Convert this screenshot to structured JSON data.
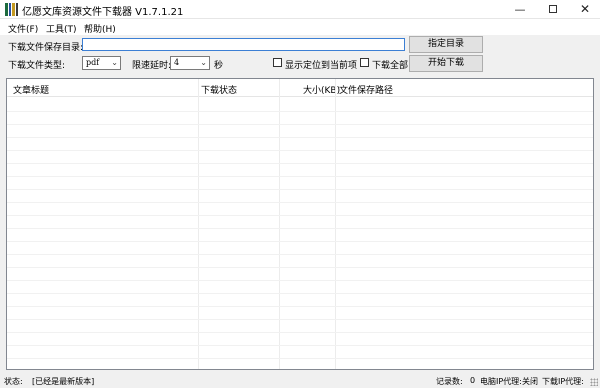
{
  "window": {
    "title": "亿愿文库资源文件下载器 V1.7.1.21",
    "minimize": "—",
    "close": "✕"
  },
  "menu": {
    "file": "文件(F)",
    "tools": "工具(T)",
    "help": "帮助(H)"
  },
  "form": {
    "dir_label": "下载文件保存目录:",
    "dir_value": "",
    "choose_dir_button": "指定目录",
    "type_label": "下载文件类型:",
    "type_value": "pdf",
    "delay_label": "限速延时:",
    "delay_value": "4",
    "delay_unit": "秒",
    "show_current_label": "显示定位到当前项",
    "show_current_checked": false,
    "download_all_label": "下载全部",
    "download_all_checked": false,
    "start_button": "开始下载"
  },
  "table": {
    "columns": [
      "文章标题",
      "下载状态",
      "大小(KB)",
      "文件保存路径"
    ],
    "rows": []
  },
  "status": {
    "label": "状态:",
    "value": "[已经是最新版本]",
    "records_label": "记录数:",
    "records_value": "0",
    "pc_proxy_label": "电脑IP代理:",
    "pc_proxy_value": "关闭",
    "download_proxy_label": "下载IP代理:"
  },
  "icons": {
    "app": "books-icon",
    "dropdown": "chevron-down-icon",
    "grip": "resize-grip-icon"
  }
}
